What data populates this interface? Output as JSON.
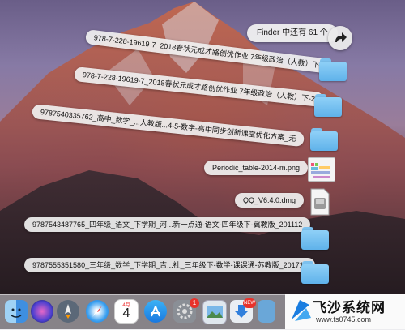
{
  "finder_more": "Finder 中还有 61 个",
  "stack_items": [
    {
      "label": "978-7-228-19619-7_2018春状元成才路创优作业 7年级政治（人教）下"
    },
    {
      "label": "978-7-228-19619-7_2018春状元成才路创优作业 7年级政治（人教）下-2"
    },
    {
      "label": "9787540335762_高中_数学_...人教版...4-5-数学-高中同步创新课堂优化方案_无"
    },
    {
      "label": "Periodic_table-2014-m.png"
    },
    {
      "label": "QQ_V6.4.0.dmg"
    },
    {
      "label": "9787543487765_四年级_语文_下学期_河...新一点通-语文-四年级下-冀教版_201112"
    },
    {
      "label": "9787555351580_三年级_数学_下学期_吉...社_三年级下-数学-课课通-苏教版_201711"
    }
  ],
  "dock": {
    "items": [
      "finder-icon",
      "siri-icon",
      "launchpad-icon",
      "safari-icon",
      "calendar-icon",
      "app-store-icon",
      "system-preferences-icon",
      "preview-icon",
      "downloads-stack-icon"
    ],
    "calendar_month": "4月",
    "calendar_day": "4",
    "prefs_badge": "1",
    "new_badge": "NEW"
  },
  "watermark": {
    "title": "飞沙系统网",
    "url": "www.fs0745.com"
  },
  "colors": {
    "folder": "#6ab8ee",
    "badge": "#e8322b",
    "accent": "#1a7de0"
  }
}
